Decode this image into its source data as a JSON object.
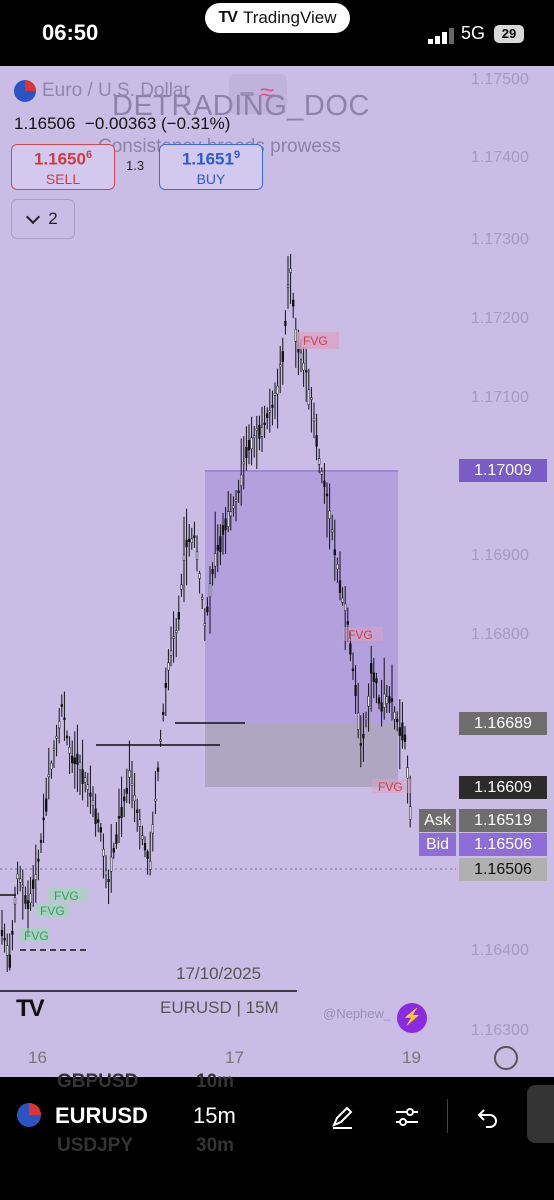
{
  "status_bar": {
    "time": "06:50",
    "app_pill": "TradingView",
    "network": "5G",
    "battery": "29"
  },
  "header": {
    "pair_name": "Euro / U.S. Dollar",
    "watermark": "DETRADING_DOC",
    "watermark_sub": "Consistency breeds prowess",
    "last_price": "1.16506",
    "change": "−0.00363 (−0.31%)",
    "sell": {
      "price_main": "1.1650",
      "price_sup": "6",
      "label": "SELL"
    },
    "buy": {
      "price_main": "1.1651",
      "price_sup": "9",
      "label": "BUY"
    },
    "spread": "1.3",
    "indicators_count": "2"
  },
  "price_axis": {
    "ticks": [
      "1.17500",
      "1.17400",
      "1.17300",
      "1.17200",
      "1.17100",
      "1.16900",
      "1.16800",
      "1.16400",
      "1.16300"
    ],
    "tags": [
      {
        "value": "1.17009",
        "color": "#7a5cc7"
      },
      {
        "value": "1.16689",
        "color": "#6e6e6e"
      },
      {
        "value": "1.16609",
        "color": "#2b2b2b"
      },
      {
        "value": "1.16519",
        "color": "#6e6e6e"
      },
      {
        "value": "1.16506",
        "color": "#8e6dd6"
      },
      {
        "value": "1.16506",
        "color": "#b0b0b0"
      }
    ],
    "ask_label": "Ask",
    "bid_label": "Bid"
  },
  "annotations": {
    "fvg": "FVG",
    "date_label": "17/10/2025",
    "symbol_tf": "EURUSD | 15M",
    "credit": "@Nephew_"
  },
  "time_axis": [
    "16",
    "17",
    "19"
  ],
  "bottom_bar": {
    "symbol": "EURUSD",
    "timeframe": "15m",
    "ghost_items": [
      "GBPUSD",
      "10m",
      "USDJPY",
      "30m"
    ]
  }
}
